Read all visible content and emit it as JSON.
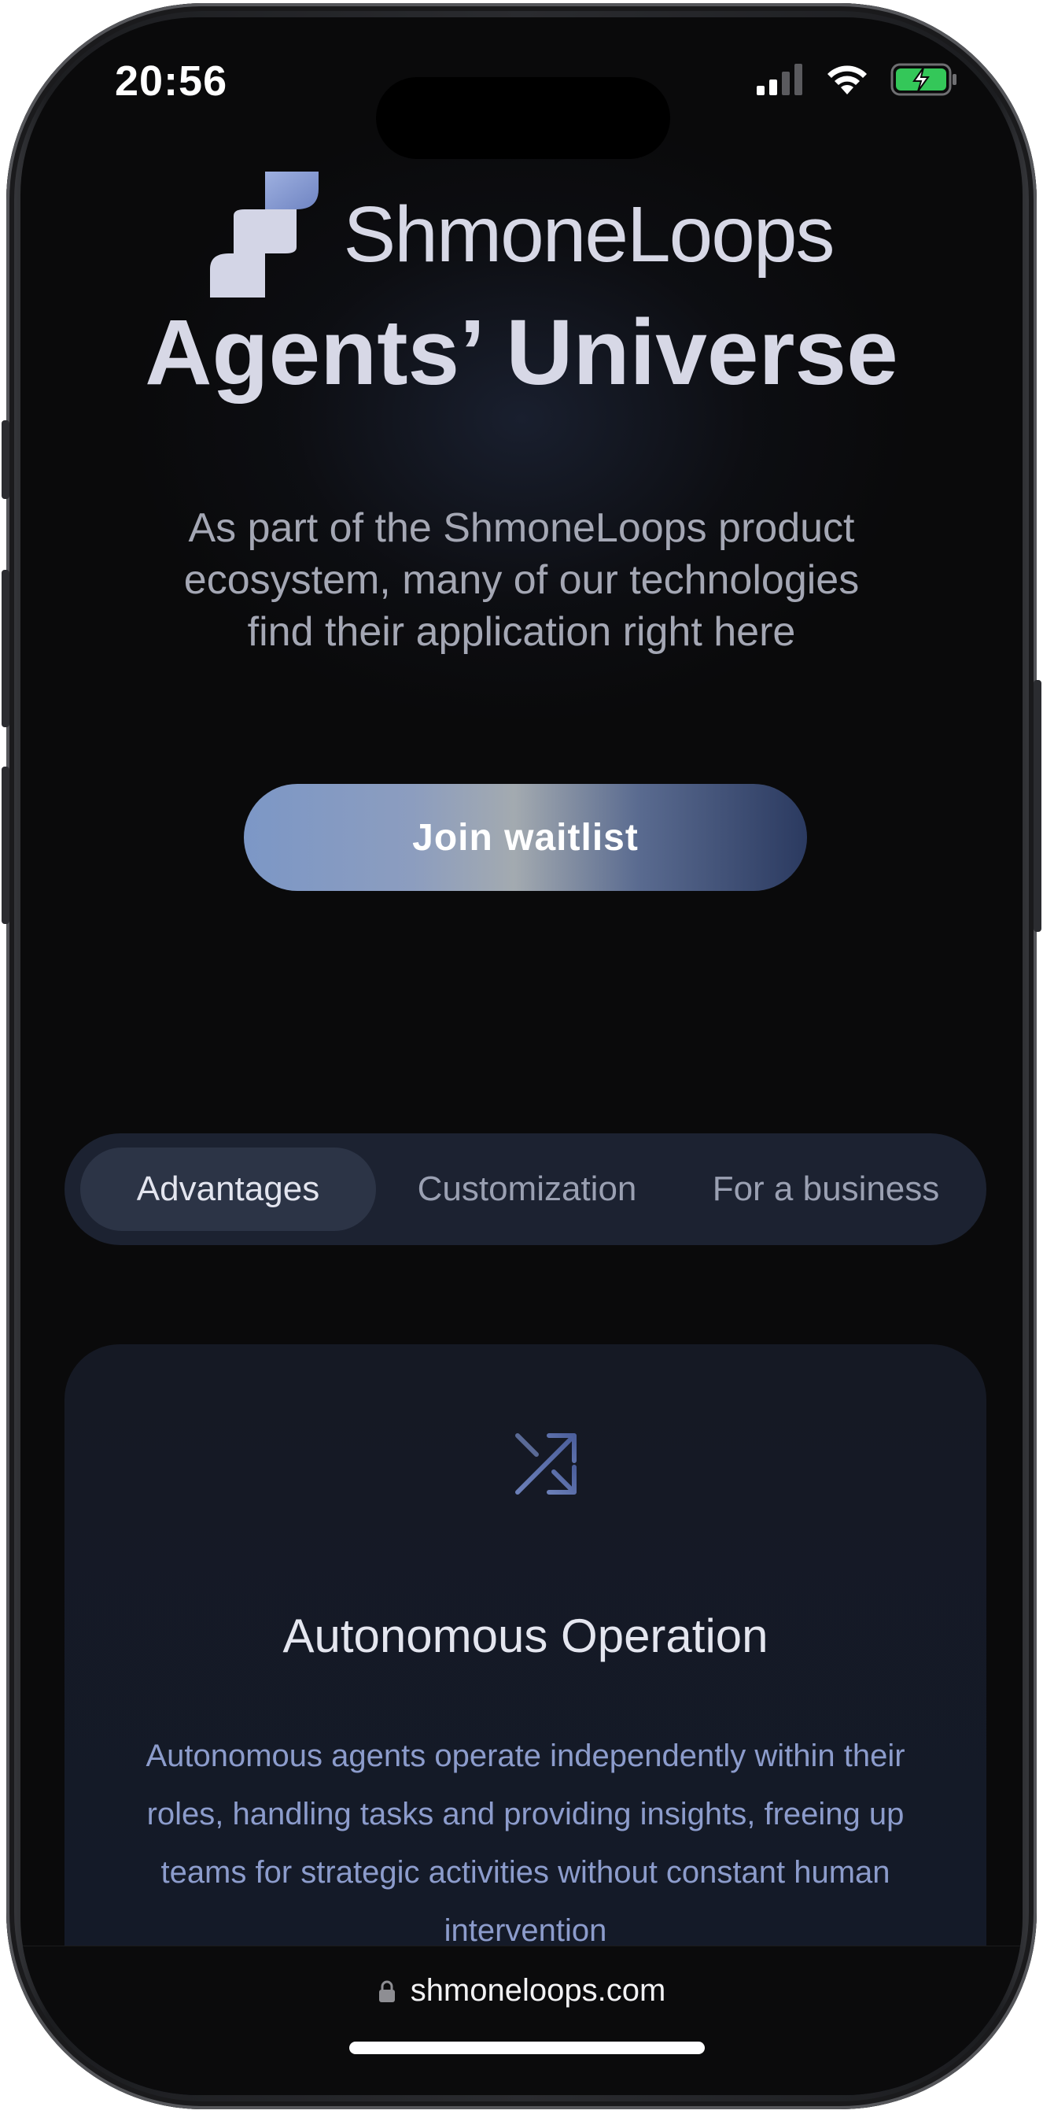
{
  "status_bar": {
    "time": "20:56"
  },
  "brand": {
    "name": "ShmoneLoops",
    "logo_icon": "shmoneloops-logo-icon"
  },
  "hero": {
    "title": "Agents’ Universe",
    "subtitle": "As part of the ShmoneLoops product ecosystem, many of our technologies find their application right here",
    "cta_label": "Join waitlist"
  },
  "tabs": [
    {
      "label": "Advantages",
      "active": true
    },
    {
      "label": "Customization",
      "active": false
    },
    {
      "label": "For a business",
      "active": false
    }
  ],
  "card": {
    "icon": "shuffle-icon",
    "title": "Autonomous Operation",
    "text": "Autonomous agents operate independently within their roles, handling tasks and providing insights, freeing up teams for strategic activities without constant human intervention"
  },
  "browser": {
    "url": "shmoneloops.com",
    "lock_icon": "lock-icon"
  },
  "colors": {
    "background": "#0a0a0b",
    "brand_text": "#d7d8e6",
    "tab_bar": "#1c2231",
    "tab_active": "#2c3446",
    "card_text": "#8c9ccc",
    "battery_green": "#34c759"
  }
}
